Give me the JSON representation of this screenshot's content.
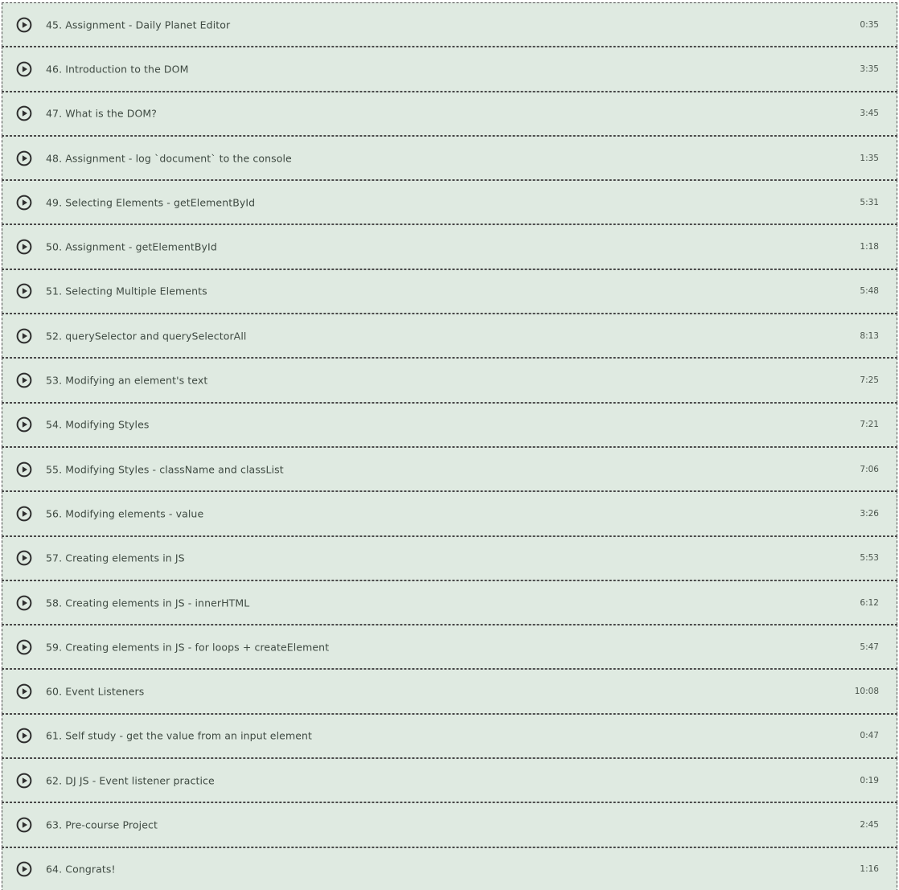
{
  "colors": {
    "row_background": "#dfeae1",
    "border": "#4a4a4a",
    "text": "#3f4a42",
    "icon": "#2e2e2e"
  },
  "lessons": [
    {
      "title": "45. Assignment - Daily Planet Editor",
      "duration": "0:35",
      "icon": "play-circle-icon"
    },
    {
      "title": "46. Introduction to the DOM",
      "duration": "3:35",
      "icon": "play-circle-icon"
    },
    {
      "title": "47. What is the DOM?",
      "duration": "3:45",
      "icon": "play-circle-icon"
    },
    {
      "title": "48. Assignment - log `document` to the console",
      "duration": "1:35",
      "icon": "play-circle-icon"
    },
    {
      "title": "49. Selecting Elements - getElementById",
      "duration": "5:31",
      "icon": "play-circle-icon"
    },
    {
      "title": "50. Assignment - getElementById",
      "duration": "1:18",
      "icon": "play-circle-icon"
    },
    {
      "title": "51. Selecting Multiple Elements",
      "duration": "5:48",
      "icon": "play-circle-icon"
    },
    {
      "title": "52. querySelector and querySelectorAll",
      "duration": "8:13",
      "icon": "play-circle-icon"
    },
    {
      "title": "53. Modifying an element's text",
      "duration": "7:25",
      "icon": "play-circle-icon"
    },
    {
      "title": "54. Modifying Styles",
      "duration": "7:21",
      "icon": "play-circle-icon"
    },
    {
      "title": "55. Modifying Styles - className and classList",
      "duration": "7:06",
      "icon": "play-circle-icon"
    },
    {
      "title": "56. Modifying elements - value",
      "duration": "3:26",
      "icon": "play-circle-icon"
    },
    {
      "title": "57. Creating elements in JS",
      "duration": "5:53",
      "icon": "play-circle-icon"
    },
    {
      "title": "58. Creating elements in JS - innerHTML",
      "duration": "6:12",
      "icon": "play-circle-icon"
    },
    {
      "title": "59. Creating elements in JS - for loops + createElement",
      "duration": "5:47",
      "icon": "play-circle-icon"
    },
    {
      "title": "60. Event Listeners",
      "duration": "10:08",
      "icon": "play-circle-icon"
    },
    {
      "title": "61. Self study - get the value from an input element",
      "duration": "0:47",
      "icon": "play-circle-icon"
    },
    {
      "title": "62. DJ JS - Event listener practice",
      "duration": "0:19",
      "icon": "play-circle-icon"
    },
    {
      "title": "63. Pre-course Project",
      "duration": "2:45",
      "icon": "play-circle-icon"
    },
    {
      "title": "64. Congrats!",
      "duration": "1:16",
      "icon": "play-circle-icon"
    }
  ]
}
